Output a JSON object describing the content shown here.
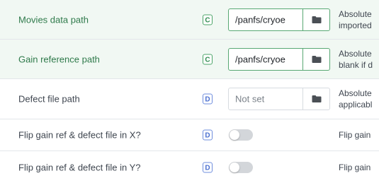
{
  "rows": [
    {
      "label": "Movies data path",
      "type_badge": "C",
      "value": "/panfs/cryoe",
      "description_lines": [
        "Absolute",
        "imported"
      ]
    },
    {
      "label": "Gain reference path",
      "type_badge": "C",
      "value": "/panfs/cryoe",
      "description_lines": [
        "Absolute",
        "blank if d"
      ]
    },
    {
      "label": "Defect file path",
      "type_badge": "D",
      "value": "Not set",
      "description_lines": [
        "Absolute",
        "applicabl"
      ]
    },
    {
      "label": "Flip gain ref & defect file in X?",
      "type_badge": "D",
      "toggle_on": false,
      "description_lines": [
        "Flip gain"
      ]
    },
    {
      "label": "Flip gain ref & defect file in Y?",
      "type_badge": "D",
      "toggle_on": false,
      "description_lines": [
        "Flip gain"
      ]
    }
  ],
  "icons": {
    "browse": "folder-icon"
  },
  "colors": {
    "set_row_background": "#f1f8f3",
    "set_label": "#2f7a4b",
    "badge_c": "#2f8a4f",
    "badge_d": "#4a6fd0",
    "toggle_off": "#d3d6da"
  }
}
